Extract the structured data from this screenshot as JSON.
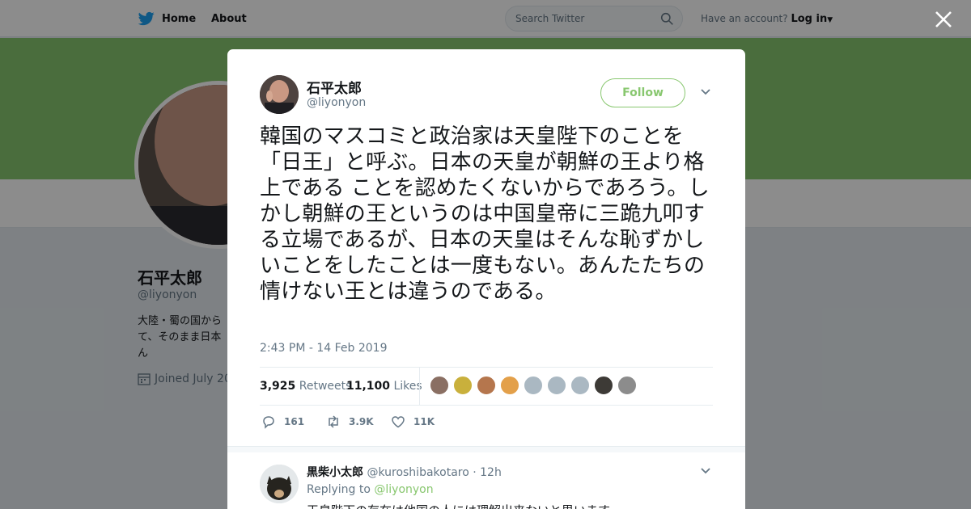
{
  "topbar": {
    "home_label": "Home",
    "about_label": "About",
    "search_placeholder": "Search Twitter",
    "account_prompt": "Have an account?",
    "login_label": "Log in"
  },
  "profile": {
    "name": "石平太郎",
    "handle": "@liyonyon",
    "bio": "大陸・蜀の国から て、そのまま日本 ん",
    "joined": "Joined July 20"
  },
  "tweet": {
    "author_name": "石平太郎",
    "author_handle": "@liyonyon",
    "follow_label": "Follow",
    "text": "韓国のマスコミと政治家は天皇陛下のことを「日王」と呼ぶ。日本の天皇が朝鮮の王より格上である ことを認めたくないからであろう。しかし朝鮮の王というのは中国皇帝に三跪九叩する立場であるが、日本の天皇はそんな恥ずかしいことをしたことは一度もない。あんたたちの情けない王とは違うのである。",
    "timestamp": "2:43 PM - 14 Feb 2019",
    "retweets_count": "3,925",
    "retweets_label": "Retweets",
    "likes_count": "11,100",
    "likes_label": "Likes",
    "reply_action_count": "161",
    "retweet_action_count": "3.9K",
    "like_action_count": "11K",
    "liker_colors": [
      "#8a6f63",
      "#c9b03c",
      "#b5764d",
      "#e3a04a",
      "#aab8c2",
      "#aab8c2",
      "#aab8c2",
      "#3d3a36",
      "#8c8c8c"
    ]
  },
  "reply": {
    "author_name": "黒柴小太郎",
    "author_handle": "@kuroshibakotaro",
    "age": "· 12h",
    "replying_prefix": "Replying to",
    "replying_to": "@liyonyon",
    "text": "天皇陛下の存在は他国の人には理解出来ないと思います"
  },
  "colors": {
    "accent": "#88c76f",
    "link_blue": "#1da1f2"
  }
}
